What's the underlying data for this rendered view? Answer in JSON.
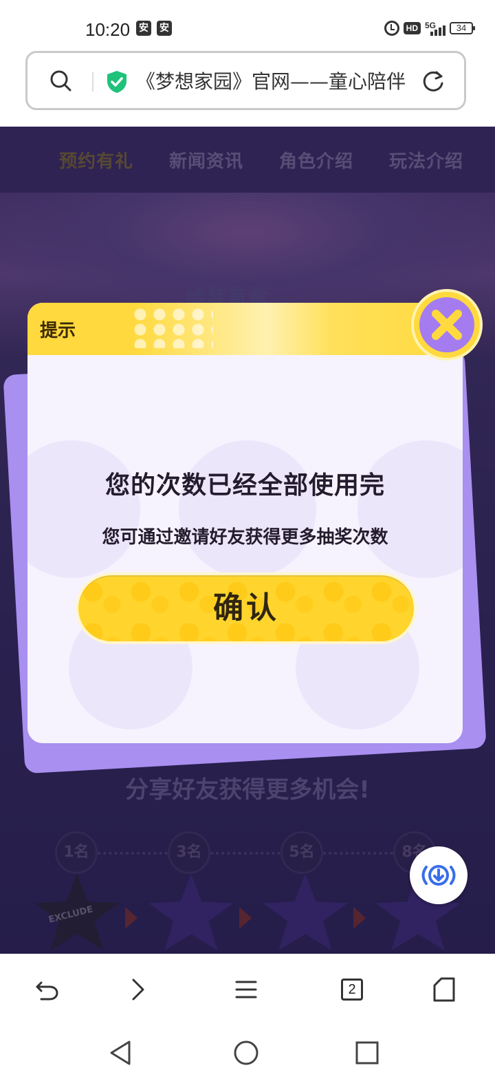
{
  "status_bar": {
    "time": "10:20",
    "notif_icons": [
      "app-notification-icon",
      "app-notification-icon"
    ],
    "notif_glyph": "安",
    "hd": "HD",
    "network": "5G",
    "battery": "34"
  },
  "address_bar": {
    "page_title": "《梦想家园》官网——童心陪伴"
  },
  "nav": {
    "items": [
      {
        "label": "预约有礼",
        "active": true
      },
      {
        "label": "新闻资讯",
        "active": false
      },
      {
        "label": "角色介绍",
        "active": false
      },
      {
        "label": "玩法介绍",
        "active": false
      }
    ]
  },
  "background": {
    "banner_title": "绘梦盲盒",
    "share_title": "分享好友获得更多机会!",
    "steps": [
      "1名",
      "3名",
      "5名",
      "8名"
    ],
    "first_reward_label": "EXCLUDE"
  },
  "dialog": {
    "title": "提示",
    "message": "您的次数已经全部使用完",
    "sub_message": "您可通过邀请好友获得更多抽奖次数",
    "confirm_label": "确认"
  },
  "toolbar": {
    "tab_count": "2"
  },
  "colors": {
    "accent_yellow": "#ffd93d",
    "dialog_purple": "#a98ff0",
    "page_bg": "#3d3270"
  }
}
